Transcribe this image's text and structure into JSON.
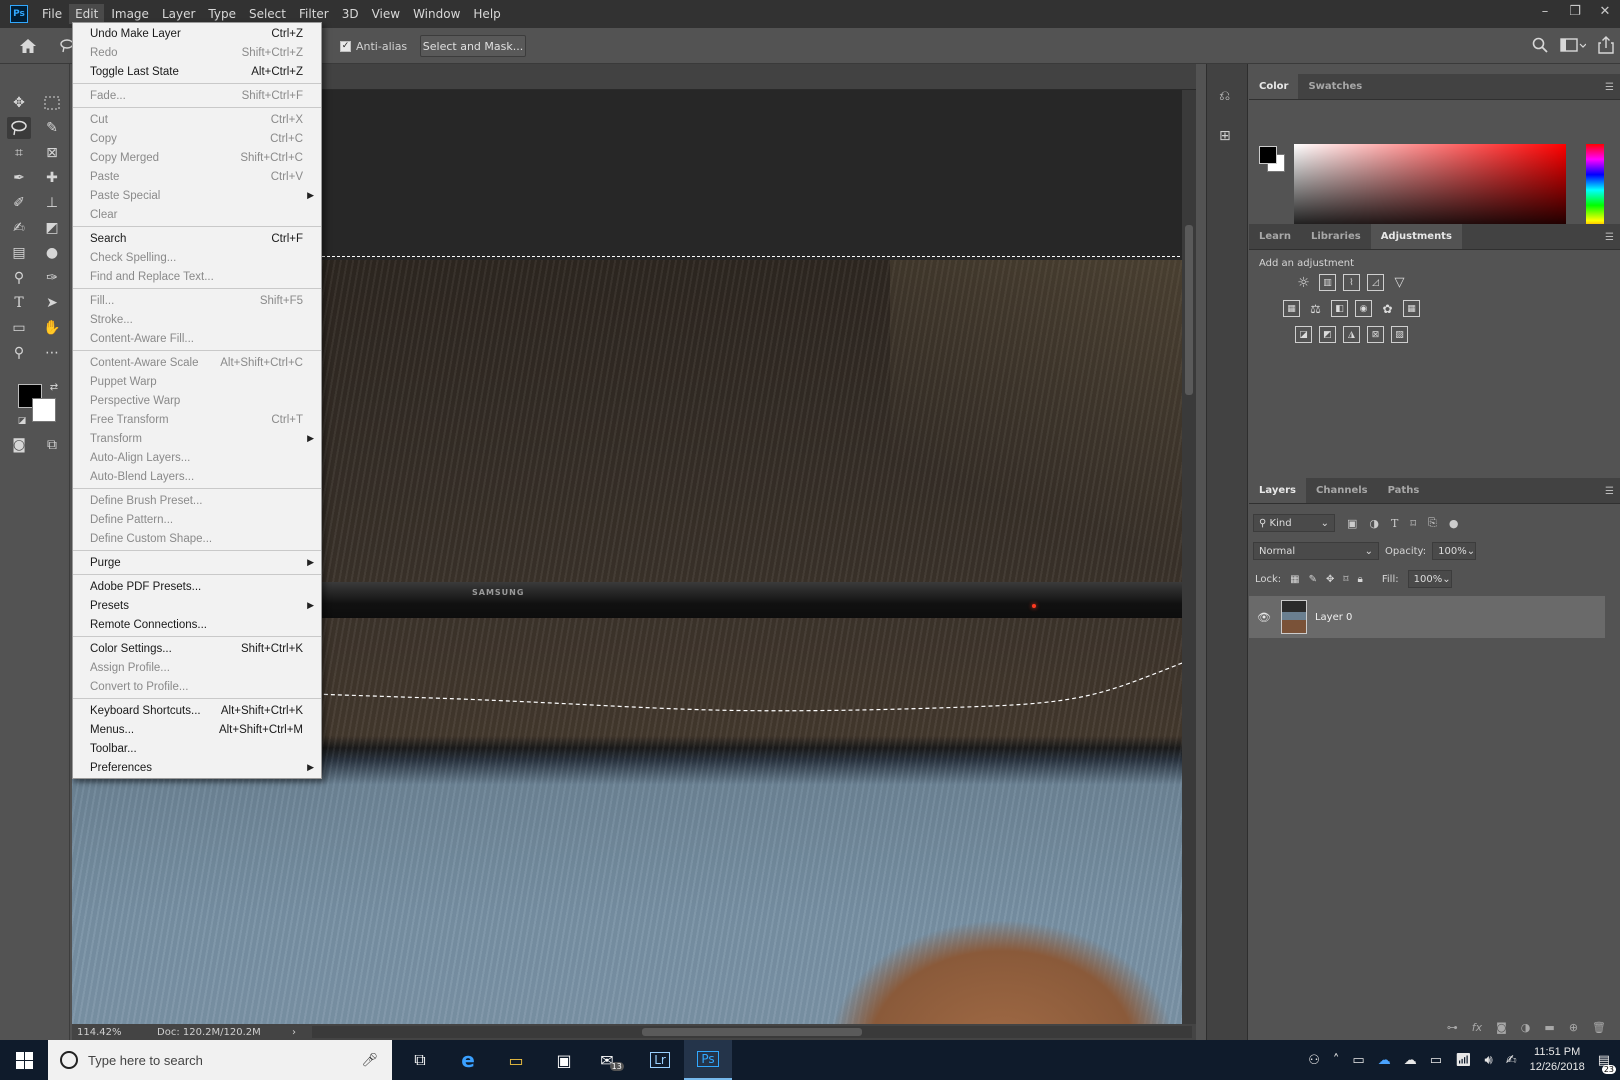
{
  "app": {
    "logo_text": "Ps"
  },
  "menubar": [
    {
      "label": "File"
    },
    {
      "label": "Edit"
    },
    {
      "label": "Image"
    },
    {
      "label": "Layer"
    },
    {
      "label": "Type"
    },
    {
      "label": "Select"
    },
    {
      "label": "Filter"
    },
    {
      "label": "3D"
    },
    {
      "label": "View"
    },
    {
      "label": "Window"
    },
    {
      "label": "Help"
    }
  ],
  "options": {
    "antialias_label": "Anti-alias",
    "antialias_checked": true,
    "select_mask_label": "Select and Mask..."
  },
  "edit_menu": [
    {
      "label": "Undo Make Layer",
      "shortcut": "Ctrl+Z",
      "enabled": true
    },
    {
      "label": "Redo",
      "shortcut": "Shift+Ctrl+Z",
      "enabled": false
    },
    {
      "label": "Toggle Last State",
      "shortcut": "Alt+Ctrl+Z",
      "enabled": true
    },
    {
      "sep": true
    },
    {
      "label": "Fade...",
      "shortcut": "Shift+Ctrl+F",
      "enabled": false
    },
    {
      "sep": true
    },
    {
      "label": "Cut",
      "shortcut": "Ctrl+X",
      "enabled": false
    },
    {
      "label": "Copy",
      "shortcut": "Ctrl+C",
      "enabled": false
    },
    {
      "label": "Copy Merged",
      "shortcut": "Shift+Ctrl+C",
      "enabled": false
    },
    {
      "label": "Paste",
      "shortcut": "Ctrl+V",
      "enabled": false
    },
    {
      "label": "Paste Special",
      "shortcut": "",
      "enabled": false,
      "submenu": true
    },
    {
      "label": "Clear",
      "shortcut": "",
      "enabled": false
    },
    {
      "sep": true
    },
    {
      "label": "Search",
      "shortcut": "Ctrl+F",
      "enabled": true
    },
    {
      "label": "Check Spelling...",
      "shortcut": "",
      "enabled": false
    },
    {
      "label": "Find and Replace Text...",
      "shortcut": "",
      "enabled": false
    },
    {
      "sep": true
    },
    {
      "label": "Fill...",
      "shortcut": "Shift+F5",
      "enabled": false
    },
    {
      "label": "Stroke...",
      "shortcut": "",
      "enabled": false
    },
    {
      "label": "Content-Aware Fill...",
      "shortcut": "",
      "enabled": false
    },
    {
      "sep": true
    },
    {
      "label": "Content-Aware Scale",
      "shortcut": "Alt+Shift+Ctrl+C",
      "enabled": false
    },
    {
      "label": "Puppet Warp",
      "shortcut": "",
      "enabled": false
    },
    {
      "label": "Perspective Warp",
      "shortcut": "",
      "enabled": false
    },
    {
      "label": "Free Transform",
      "shortcut": "Ctrl+T",
      "enabled": false
    },
    {
      "label": "Transform",
      "shortcut": "",
      "enabled": false,
      "submenu": true
    },
    {
      "label": "Auto-Align Layers...",
      "shortcut": "",
      "enabled": false
    },
    {
      "label": "Auto-Blend Layers...",
      "shortcut": "",
      "enabled": false
    },
    {
      "sep": true
    },
    {
      "label": "Define Brush Preset...",
      "shortcut": "",
      "enabled": false
    },
    {
      "label": "Define Pattern...",
      "shortcut": "",
      "enabled": false
    },
    {
      "label": "Define Custom Shape...",
      "shortcut": "",
      "enabled": false
    },
    {
      "sep": true
    },
    {
      "label": "Purge",
      "shortcut": "",
      "enabled": true,
      "submenu": true
    },
    {
      "sep": true
    },
    {
      "label": "Adobe PDF Presets...",
      "shortcut": "",
      "enabled": true
    },
    {
      "label": "Presets",
      "shortcut": "",
      "enabled": true,
      "submenu": true
    },
    {
      "label": "Remote Connections...",
      "shortcut": "",
      "enabled": true
    },
    {
      "sep": true
    },
    {
      "label": "Color Settings...",
      "shortcut": "Shift+Ctrl+K",
      "enabled": true
    },
    {
      "label": "Assign Profile...",
      "shortcut": "",
      "enabled": false
    },
    {
      "label": "Convert to Profile...",
      "shortcut": "",
      "enabled": false
    },
    {
      "sep": true
    },
    {
      "label": "Keyboard Shortcuts...",
      "shortcut": "Alt+Shift+Ctrl+K",
      "enabled": true
    },
    {
      "label": "Menus...",
      "shortcut": "Alt+Shift+Ctrl+M",
      "enabled": true
    },
    {
      "label": "Toolbar...",
      "shortcut": "",
      "enabled": true
    },
    {
      "label": "Preferences",
      "shortcut": "",
      "enabled": true,
      "submenu": true
    }
  ],
  "canvas": {
    "tv_brand": "SAMSUNG"
  },
  "status": {
    "zoom": "114.42%",
    "doc": "Doc: 120.2M/120.2M",
    "arrow": "›"
  },
  "color_panel": {
    "tabs": [
      "Color",
      "Swatches"
    ],
    "active_tab": "Color"
  },
  "adjust_panel": {
    "tabs": [
      "Learn",
      "Libraries",
      "Adjustments"
    ],
    "active_tab": "Adjustments",
    "heading": "Add an adjustment"
  },
  "layers_panel": {
    "tabs": [
      "Layers",
      "Channels",
      "Paths"
    ],
    "active_tab": "Layers",
    "filter_kind": "Kind",
    "blend_mode": "Normal",
    "opacity_label": "Opacity:",
    "opacity_value": "100%",
    "lock_label": "Lock:",
    "fill_label": "Fill:",
    "fill_value": "100%",
    "layers": [
      {
        "name": "Layer 0",
        "visible": true
      }
    ]
  },
  "taskbar": {
    "search_placeholder": "Type here to search",
    "apps": [
      {
        "icon": "task-view-icon",
        "glyph": "⧉"
      },
      {
        "icon": "edge-icon",
        "glyph": "e"
      },
      {
        "icon": "file-explorer-icon",
        "glyph": "▭"
      },
      {
        "icon": "store-icon",
        "glyph": "▣"
      },
      {
        "icon": "mail-icon",
        "glyph": "✉",
        "badge": "13"
      },
      {
        "icon": "lightroom-icon",
        "glyph": "Lr"
      },
      {
        "icon": "photoshop-icon",
        "glyph": "Ps",
        "active": true
      }
    ],
    "time": "11:51 PM",
    "date": "12/26/2018",
    "notif_count": "23"
  },
  "colors": {
    "accent": "#31a8ff",
    "panel_bg": "#535353",
    "menu_bg": "#f2f2f2",
    "taskbar_bg": "#0f1b2b"
  }
}
